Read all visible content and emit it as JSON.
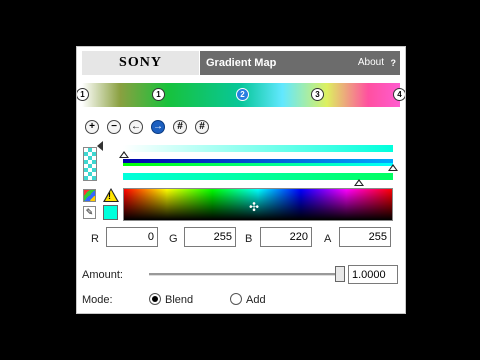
{
  "header": {
    "brand": "SONY",
    "title": "Gradient Map",
    "about": "About",
    "help_glyph": "?"
  },
  "gradient": {
    "stops": [
      {
        "label": "1",
        "selected": false,
        "position": 0.0
      },
      {
        "label": "1",
        "selected": false,
        "position": 0.24
      },
      {
        "label": "2",
        "selected": true,
        "position": 0.505
      },
      {
        "label": "3",
        "selected": false,
        "position": 0.75
      },
      {
        "label": "4",
        "selected": false,
        "position": 1.0
      }
    ]
  },
  "toolbar": {
    "tools": [
      {
        "name": "add-stop",
        "glyph": "+"
      },
      {
        "name": "remove-stop",
        "glyph": "−"
      },
      {
        "name": "select-previous",
        "glyph": "←"
      },
      {
        "name": "select-next",
        "glyph": "→",
        "active": true
      },
      {
        "name": "tool-five",
        "glyph": "#"
      },
      {
        "name": "tool-six",
        "glyph": "#"
      }
    ]
  },
  "sliders": {
    "alpha_level": 0.0,
    "blue_level": 1.0,
    "green_level": 0.86
  },
  "current_color": "#00ffdc",
  "channels": {
    "r": {
      "label": "R",
      "value": "0"
    },
    "g": {
      "label": "G",
      "value": "255"
    },
    "b": {
      "label": "B",
      "value": "220"
    },
    "a": {
      "label": "A",
      "value": "255"
    }
  },
  "amount": {
    "label": "Amount:",
    "value": "1.0000",
    "level": 1.0
  },
  "mode": {
    "label": "Mode:",
    "options": [
      {
        "label": "Blend",
        "checked": true
      },
      {
        "label": "Add",
        "checked": false
      }
    ]
  }
}
